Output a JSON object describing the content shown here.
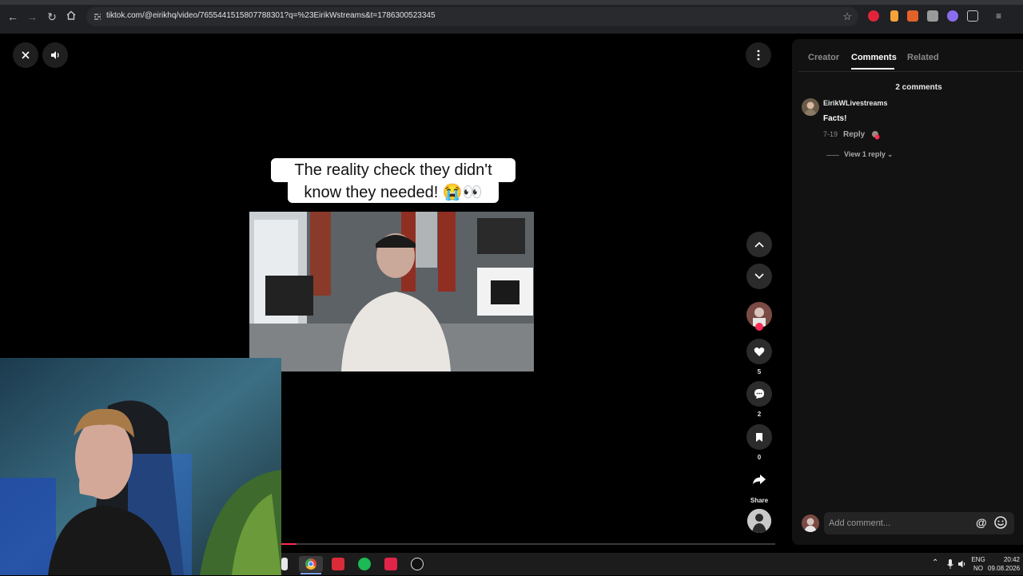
{
  "browser": {
    "url": "tiktok.com/@eirikhq/video/7655441515807788301?q=%23EirikWstreams&t=1786300523345"
  },
  "video": {
    "caption_line1": "The reality check they didn't",
    "caption_line2": "know they needed! 😭👀",
    "progress_fraction": 0.03
  },
  "actions": {
    "likes": "5",
    "comments": "2",
    "saves": "0",
    "share_label": "Share"
  },
  "panel": {
    "tabs": [
      {
        "label": "Creator"
      },
      {
        "label": "Comments"
      },
      {
        "label": "Related"
      }
    ],
    "active_tab": "Comments",
    "comment_count": "2 comments",
    "comments": [
      {
        "author": "EirikWLivestreams",
        "text": "Facts!",
        "date": "7-19",
        "reply_label": "Reply",
        "view_replies_label": "View 1 reply"
      }
    ],
    "add_comment_placeholder": "Add comment..."
  },
  "taskbar": {
    "lang_line1": "ENG",
    "lang_line2": "NO",
    "time": "20:42",
    "date": "09.08.2026"
  },
  "colors": {
    "accent": "#fe2c55",
    "panel_bg": "#121212",
    "chrome_bg": "#202124"
  }
}
